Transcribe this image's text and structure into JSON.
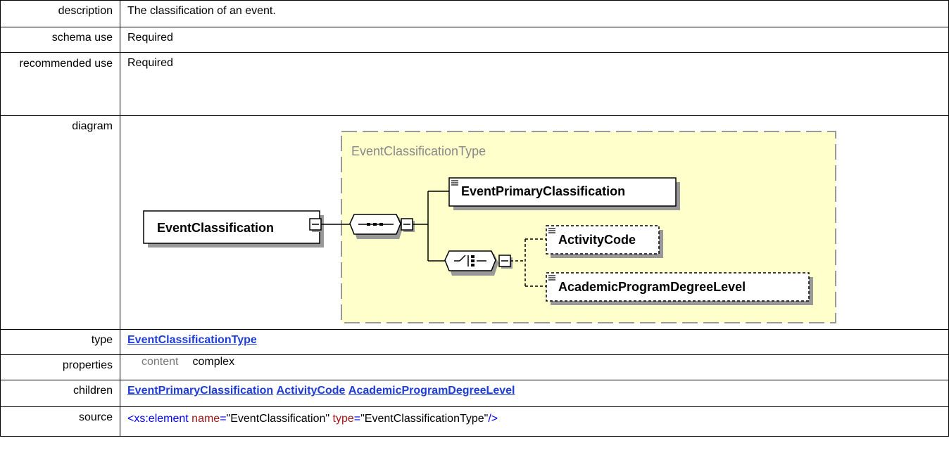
{
  "rows": {
    "description": {
      "label": "description",
      "value": "The classification of an event."
    },
    "schema_use": {
      "label": "schema use",
      "value": "Required"
    },
    "recommended_use": {
      "label": "recommended use",
      "value": "Required"
    },
    "diagram": {
      "label": "diagram",
      "type_box_label": "EventClassificationType",
      "root_element": "EventClassification",
      "child_primary": "EventPrimaryClassification",
      "child_activity": "ActivityCode",
      "child_degree": "AcademicProgramDegreeLevel"
    },
    "type": {
      "label": "type",
      "value": "EventClassificationType"
    },
    "properties": {
      "label": "properties",
      "prop_name": "content",
      "prop_value": "complex"
    },
    "children": {
      "label": "children",
      "items": [
        "EventPrimaryClassification",
        "ActivityCode",
        "AcademicProgramDegreeLevel"
      ]
    },
    "source": {
      "label": "source",
      "open": "<xs:element",
      "attr1_name": "name",
      "eq": "=",
      "attr1_value": "\"EventClassification\"",
      "attr2_name": "type",
      "attr2_value": "\"EventClassificationType\"",
      "close": "/>"
    }
  },
  "colors": {
    "label_gray": "#777777",
    "link_blue": "#1f3bd6",
    "diagram_yellow": "#ffffcc",
    "code_blue": "#0000ff",
    "code_red": "#a31515"
  }
}
